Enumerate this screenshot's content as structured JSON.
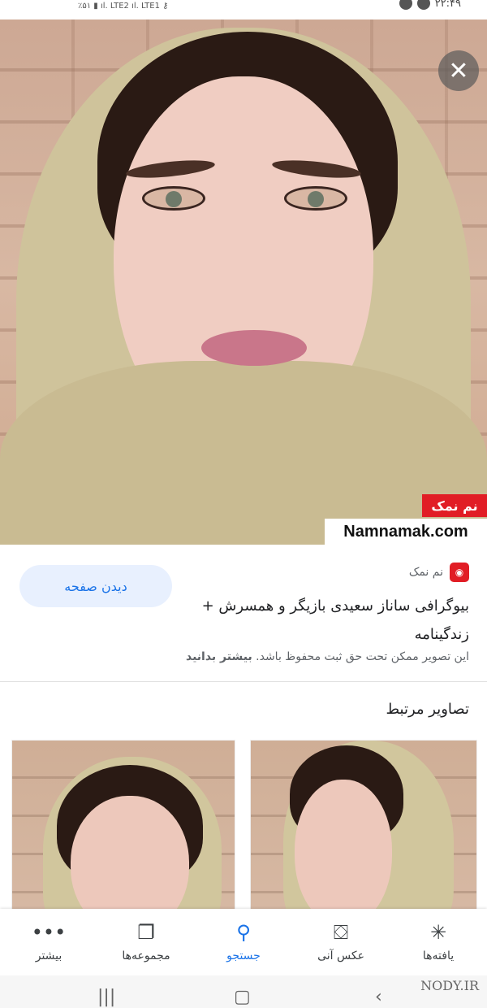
{
  "status_bar": {
    "left_text": "٪۵۱ ▮ ıl. LTE2 ıl. LTE1 ⚷",
    "time": "۲۲:۴۹"
  },
  "image": {
    "close_icon": "✕",
    "watermark_red": "نم نمک",
    "watermark_site": "Namnamak.com"
  },
  "result": {
    "visit_button": "دیدن صفحه",
    "source_name": "نم نمک",
    "title": "بیوگرافی ساناز سعیدی بازیگر و همسرش + زندگینامه",
    "copyright_text": "این تصویر ممکن تحت حق ثبت محفوظ باشد.",
    "learn_more": "بیشتر بدانید"
  },
  "related": {
    "title": "تصاویر مرتبط"
  },
  "bottom_nav": {
    "items": [
      {
        "label": "یافته‌ها",
        "icon": "discover-icon",
        "glyph": "✳"
      },
      {
        "label": "عکس آنی",
        "icon": "snapshot-icon",
        "glyph": "⛋"
      },
      {
        "label": "جستجو",
        "icon": "search-icon",
        "glyph": "⚲"
      },
      {
        "label": "مجموعه‌ها",
        "icon": "collections-icon",
        "glyph": "❐"
      },
      {
        "label": "بیشتر",
        "icon": "more-icon",
        "glyph": "•••"
      }
    ],
    "active_index": 2
  },
  "system_nav": {
    "recents_icon": "|||",
    "home_icon": "▢",
    "back_icon": "‹"
  },
  "site_watermark": "NODY.IR"
}
